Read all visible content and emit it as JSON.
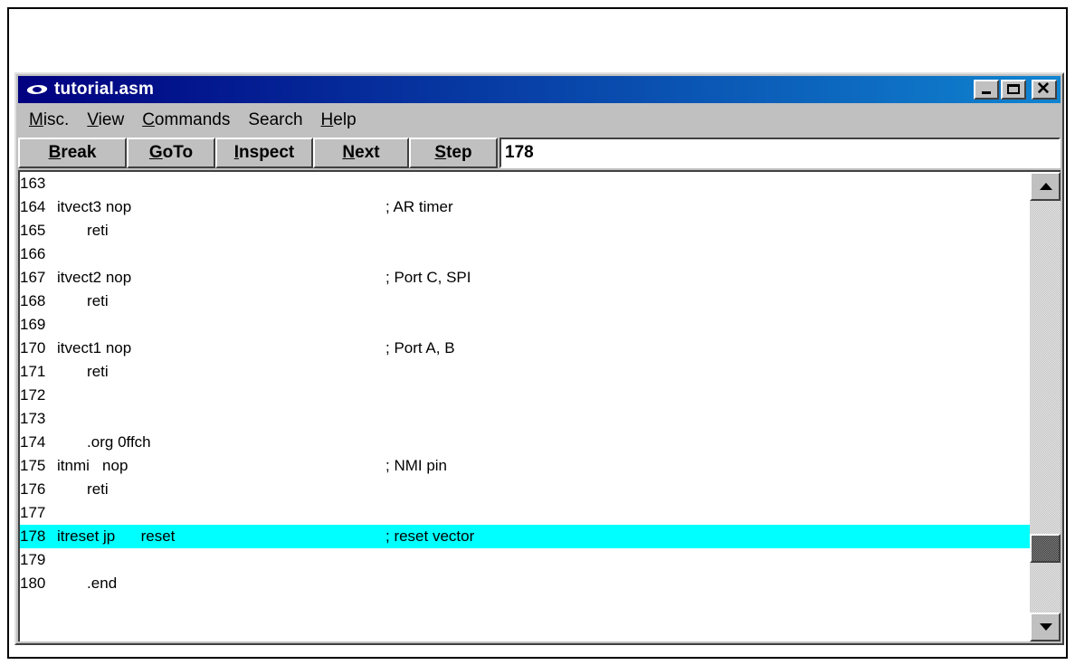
{
  "window": {
    "title": "tutorial.asm",
    "app_icon": "eye-logo-icon"
  },
  "menu": [
    {
      "label": "Misc.",
      "accel_index": 0
    },
    {
      "label": "View",
      "accel_index": 0
    },
    {
      "label": "Commands",
      "accel_index": 0
    },
    {
      "label": "Search",
      "accel_index": -1
    },
    {
      "label": "Help",
      "accel_index": 0
    }
  ],
  "toolbar": {
    "buttons": [
      {
        "pre": "",
        "ul": "B",
        "post": "reak",
        "name": "break"
      },
      {
        "pre": "",
        "ul": "G",
        "post": "oTo",
        "name": "goto"
      },
      {
        "pre": "",
        "ul": "I",
        "post": "nspect",
        "name": "inspect"
      },
      {
        "pre": "",
        "ul": "N",
        "post": "ext",
        "name": "next"
      },
      {
        "pre": "",
        "ul": "S",
        "post": "tep",
        "name": "step"
      }
    ],
    "goto_value": "178"
  },
  "code": {
    "current_line": "178",
    "highlight_color": "#00ffff",
    "lines": [
      {
        "num": "163",
        "code": "",
        "comment": ""
      },
      {
        "num": "164",
        "code": "itvect3 nop",
        "comment": "; AR timer"
      },
      {
        "num": "165",
        "code": "       reti",
        "comment": ""
      },
      {
        "num": "166",
        "code": "",
        "comment": ""
      },
      {
        "num": "167",
        "code": "itvect2 nop",
        "comment": "; Port C, SPI"
      },
      {
        "num": "168",
        "code": "       reti",
        "comment": ""
      },
      {
        "num": "169",
        "code": "",
        "comment": ""
      },
      {
        "num": "170",
        "code": "itvect1 nop",
        "comment": "; Port A, B"
      },
      {
        "num": "171",
        "code": "       reti",
        "comment": ""
      },
      {
        "num": "172",
        "code": "",
        "comment": ""
      },
      {
        "num": "173",
        "code": "",
        "comment": ""
      },
      {
        "num": "174",
        "code": "       .org 0ffch",
        "comment": ""
      },
      {
        "num": "175",
        "code": "itnmi   nop",
        "comment": "; NMI pin"
      },
      {
        "num": "176",
        "code": "       reti",
        "comment": ""
      },
      {
        "num": "177",
        "code": "",
        "comment": ""
      },
      {
        "num": "178",
        "code": "itreset jp      reset",
        "comment": "; reset vector"
      },
      {
        "num": "179",
        "code": "",
        "comment": ""
      },
      {
        "num": "180",
        "code": "       .end",
        "comment": ""
      }
    ]
  }
}
